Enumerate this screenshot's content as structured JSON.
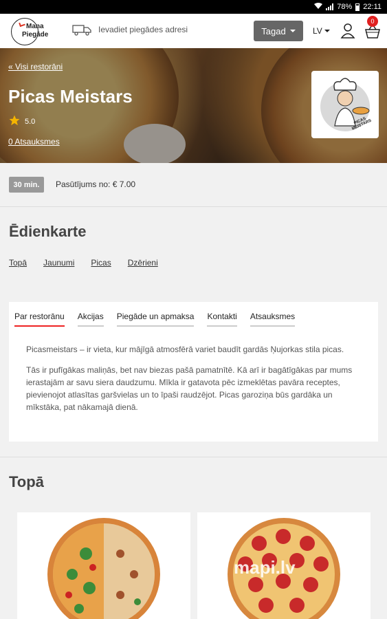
{
  "status_bar": {
    "battery": "78%",
    "time": "22:11"
  },
  "header": {
    "logo_line1": "Mana",
    "logo_line2": "Piegāde",
    "address_placeholder": "Ievadiet piegādes adresi",
    "time_button": "Tagad",
    "language": "LV",
    "cart_count": "0"
  },
  "hero": {
    "back_link": "« Visi restorāni",
    "title": "Picas Meistars",
    "rating": "5.0",
    "reviews_link": "0 Atsauksmes",
    "logo_text": "PICAS MEISTARS"
  },
  "info": {
    "delivery_time": "30 min.",
    "min_order": "Pasūtījums no: € 7.00"
  },
  "menu": {
    "title": "Ēdienkarte",
    "categories": [
      "Topā",
      "Jaunumi",
      "Picas",
      "Dzērieni"
    ]
  },
  "about": {
    "tabs": [
      "Par restorānu",
      "Akcijas",
      "Piegāde un apmaksa",
      "Kontakti",
      "Atsauksmes"
    ],
    "paragraphs": [
      "Picasmeistars – ir vieta, kur mājīgā atmosfērā variet baudīt gardās Ņujorkas stila picas.",
      "Tās ir pufīgākas maliņās, bet nav biezas pašā pamatnītē. Kā arī ir bagātīgākas par mums ierastajām ar savu siera daudzumu. Mīkla ir gatavota pēc izmeklētas pavāra receptes, pievienojot atlasītas garšvielas un to īpaši raudzējot. Picas garoziņa būs gardāka un mīkstāka, pat nākamajā dienā."
    ]
  },
  "top_section": {
    "title": "Topā",
    "watermark": "mapi.lv"
  },
  "colors": {
    "accent_red": "#e22222",
    "badge_gray": "#999999",
    "button_gray": "#666666"
  }
}
